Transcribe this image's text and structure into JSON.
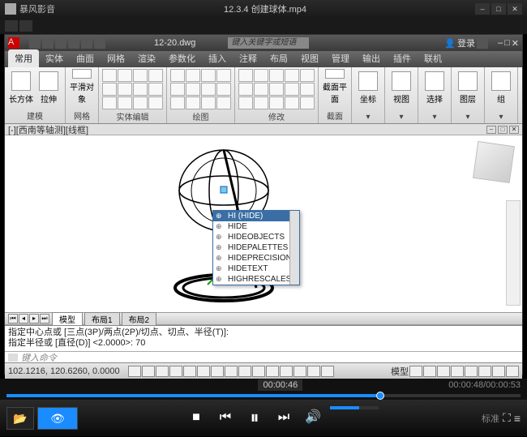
{
  "player": {
    "app_title": "暴风影音",
    "filename": "12.3.4 创建球体.mp4",
    "current_time_badge": "00:00:46",
    "elapsed_total": "00:00:48/00:00:53",
    "quality_label": "标准"
  },
  "acad": {
    "filename": "12-20.dwg",
    "search_placeholder": "键入关键字或短语",
    "login_label": "登录",
    "tabs": [
      "常用",
      "实体",
      "曲面",
      "网格",
      "渲染",
      "参数化",
      "插入",
      "注释",
      "布局",
      "视图",
      "管理",
      "输出",
      "插件",
      "联机"
    ],
    "active_tab": 0,
    "panels": {
      "modeling": {
        "label": "建模",
        "btn1": "长方体",
        "btn2": "拉伸"
      },
      "solid": {
        "label": "平滑对象"
      },
      "mesh": {
        "label": "网格"
      },
      "solidedit": {
        "label": "实体编辑"
      },
      "draw": {
        "label": "绘图"
      },
      "modify": {
        "label": "修改"
      },
      "section": {
        "label": "截面",
        "btn": "截面平面"
      },
      "coord": {
        "label": "坐标"
      },
      "view": {
        "label": "视图"
      },
      "selection": {
        "label": "选择"
      },
      "layers": {
        "label": "图层"
      },
      "group": {
        "label": "组"
      }
    },
    "viewport_label": "[-][西南等轴测][线框]",
    "autocomplete": {
      "typed": "HI",
      "items": [
        "HI (HIDE)",
        "HIDE",
        "HIDEOBJECTS",
        "HIDEPALETTES",
        "HIDEPRECISION",
        "HIDETEXT",
        "HIGHRESCALES"
      ],
      "selected": 0
    },
    "model_tabs": [
      "模型",
      "布局1",
      "布局2"
    ],
    "cmdline": {
      "line1": "指定中心点或 [三点(3P)/两点(2P)/切点、切点、半径(T)]:",
      "line2": "指定半径或 [直径(D)] <2.0000>: 70",
      "prompt": "键入命令"
    },
    "coords": "102.1216, 120.6260, 0.0000",
    "status_right": "模型"
  }
}
